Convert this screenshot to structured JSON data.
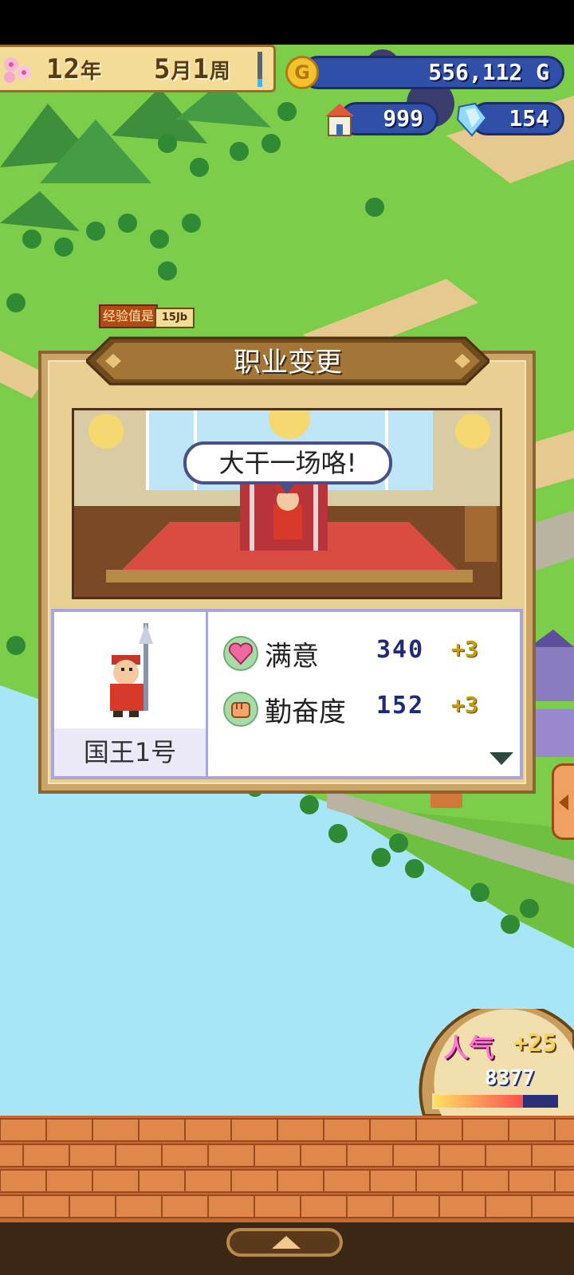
{
  "hud": {
    "date": {
      "year": "12",
      "year_unit": "年",
      "month": "5",
      "month_unit": "月",
      "week": "1",
      "week_unit": "周"
    },
    "gold": "556,112 G",
    "gold_icon_letter": "G",
    "houses": "999",
    "crystals": "154"
  },
  "map_labels": {
    "exp_tag": "经验值是",
    "level_tag": "15Jb"
  },
  "dialog": {
    "title": "职业变更",
    "speech": "大干一场咯!",
    "character_name": "国王1号",
    "stats": [
      {
        "label": "满意",
        "value": "340",
        "delta": "+3",
        "icon": "heart-icon"
      },
      {
        "label": "勤奋度",
        "value": "152",
        "delta": "+3",
        "icon": "fist-icon"
      }
    ]
  },
  "popularity": {
    "label": "人气",
    "delta": "+25",
    "value": "8377",
    "bar_fill": 0.72
  },
  "colors": {
    "water": "#a6e6f7",
    "grass": "#7ccd4a",
    "dialog_frame": "#c9a567",
    "brick": "#d3773f"
  }
}
